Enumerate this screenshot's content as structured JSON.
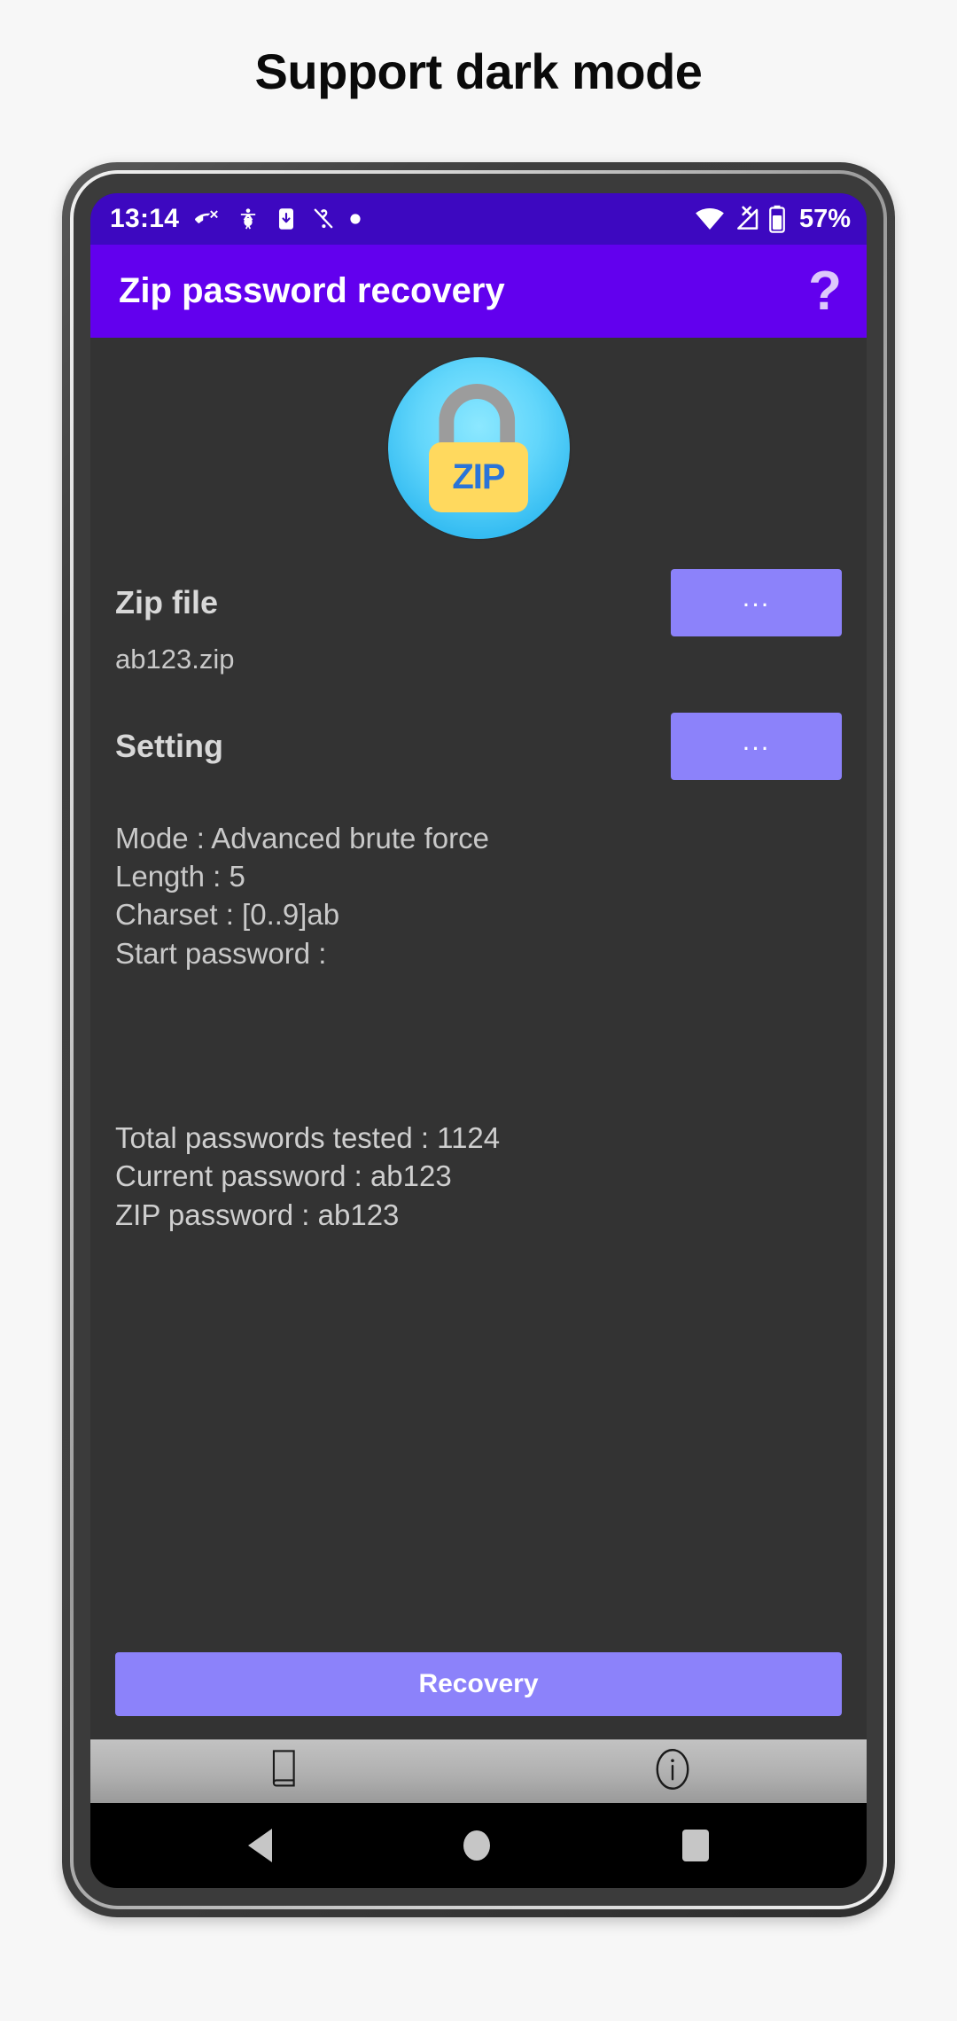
{
  "headline": "Support dark mode",
  "status_bar": {
    "time": "13:14",
    "left_icons": [
      "missed-call-icon",
      "accessibility-icon",
      "download-to-phone-icon",
      "silent-mode-icon",
      "dot-icon"
    ],
    "right_icons": [
      "wifi-icon",
      "cellular-no-signal-icon",
      "battery-icon"
    ],
    "battery_percent": "57%"
  },
  "app_bar": {
    "title": "Zip password recovery",
    "help_glyph": "?"
  },
  "logo": {
    "name": "zip-lock-logo",
    "text": "ZIP"
  },
  "zip_file": {
    "label": "Zip file",
    "browse_button": "...",
    "value": "ab123.zip"
  },
  "setting": {
    "label": "Setting",
    "browse_button": "..."
  },
  "details": {
    "mode": "Mode : Advanced brute force",
    "length": "Length : 5",
    "charset": "Charset : [0..9]ab",
    "start_password": "Start password :"
  },
  "results": {
    "total_tested": "Total passwords tested : 1124",
    "current_password": "Current password : ab123",
    "zip_password": "ZIP password : ab123"
  },
  "recovery_button": "Recovery",
  "bottom_toolbar": {
    "items": [
      {
        "name": "manual-book-icon"
      },
      {
        "name": "info-icon"
      }
    ]
  },
  "nav_bar": {
    "back": "back-icon",
    "home": "home-icon",
    "recents": "recents-icon"
  },
  "colors": {
    "status_bar": "#3d08c0",
    "app_bar": "#6200ee",
    "accent_button": "#8c82fa",
    "body_bg": "#333333",
    "page_bg": "#f7f7f7"
  }
}
